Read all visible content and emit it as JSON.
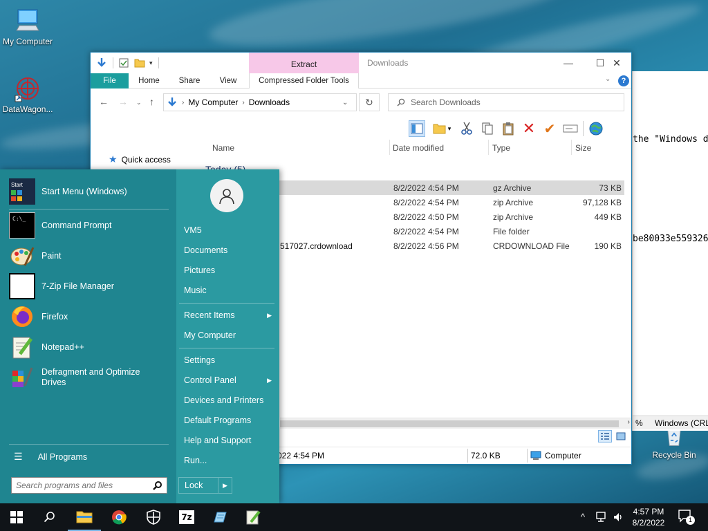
{
  "desktop": {
    "icons": [
      {
        "label": "My Computer"
      },
      {
        "label": "DataWagon..."
      },
      {
        "label": "Recycle Bin"
      }
    ]
  },
  "background_window": {
    "text_line1": "the \"Windows d",
    "text_line2": "be80033e559326",
    "status_left": "%",
    "status_right": "Windows (CRL"
  },
  "explorer": {
    "title": "Downloads",
    "context_tab_header": "Extract",
    "ribbon_tabs": [
      "File",
      "Home",
      "Share",
      "View",
      "Compressed Folder Tools"
    ],
    "breadcrumb": [
      "My Computer",
      "Downloads"
    ],
    "search_placeholder": "Search Downloads",
    "columns": [
      "Name",
      "Date modified",
      "Type",
      "Size"
    ],
    "nav_quick_access": "Quick access",
    "group_header": "Today (5)",
    "files": [
      {
        "name": "",
        "date": "8/2/2022 4:54 PM",
        "type": "gz Archive",
        "size": "73 KB"
      },
      {
        "name": "",
        "date": "8/2/2022 4:54 PM",
        "type": "zip Archive",
        "size": "97,128 KB"
      },
      {
        "name": "",
        "date": "8/2/2022 4:50 PM",
        "type": "zip Archive",
        "size": "449 KB"
      },
      {
        "name": "",
        "date": "8/2/2022 4:54 PM",
        "type": "File folder",
        "size": ""
      },
      {
        "name": "517027.crdownload",
        "date": "8/2/2022 4:56 PM",
        "type": "CRDOWNLOAD File",
        "size": "190 KB"
      }
    ],
    "status": {
      "date_modified": "022 4:54 PM",
      "size": "72.0 KB",
      "location": "Computer"
    }
  },
  "start_menu": {
    "programs": [
      {
        "label": "Start Menu (Windows)",
        "icon": "start-menu-icon"
      },
      {
        "label": "Command Prompt",
        "icon": "command-prompt-icon"
      },
      {
        "label": "Paint",
        "icon": "paint-icon"
      },
      {
        "label": "7-Zip File Manager",
        "icon": "7zip-icon"
      },
      {
        "label": "Firefox",
        "icon": "firefox-icon"
      },
      {
        "label": "Notepad++",
        "icon": "notepadpp-icon"
      },
      {
        "label": "Defragment and Optimize Drives",
        "icon": "defrag-icon"
      }
    ],
    "start_icon_label": "Start",
    "all_programs": "All Programs",
    "search_placeholder": "Search programs and files",
    "right_items": [
      {
        "label": "VM5",
        "arrow": false
      },
      {
        "label": "Documents",
        "arrow": false
      },
      {
        "label": "Pictures",
        "arrow": false
      },
      {
        "label": "Music",
        "arrow": false
      },
      {
        "label": "Recent Items",
        "arrow": true
      },
      {
        "label": "My Computer",
        "arrow": false
      },
      {
        "label": "Settings",
        "arrow": false
      },
      {
        "label": "Control Panel",
        "arrow": true
      },
      {
        "label": "Devices and Printers",
        "arrow": false
      },
      {
        "label": "Default Programs",
        "arrow": false
      },
      {
        "label": "Help and Support",
        "arrow": false
      },
      {
        "label": "Run...",
        "arrow": false
      }
    ],
    "lock_label": "Lock"
  },
  "taskbar": {
    "time": "4:57 PM",
    "date": "8/2/2022",
    "notification_count": "1",
    "apps": [
      "file-explorer-icon",
      "chrome-icon",
      "security-icon",
      "7zip-icon",
      "notepad-icon",
      "notepadpp-icon"
    ]
  },
  "colors": {
    "accent": "#1b9e9e",
    "start_left": "#1f8590",
    "start_right": "#2b9aa1",
    "taskbar": "#101418",
    "context_tab": "#f7c8e8"
  }
}
